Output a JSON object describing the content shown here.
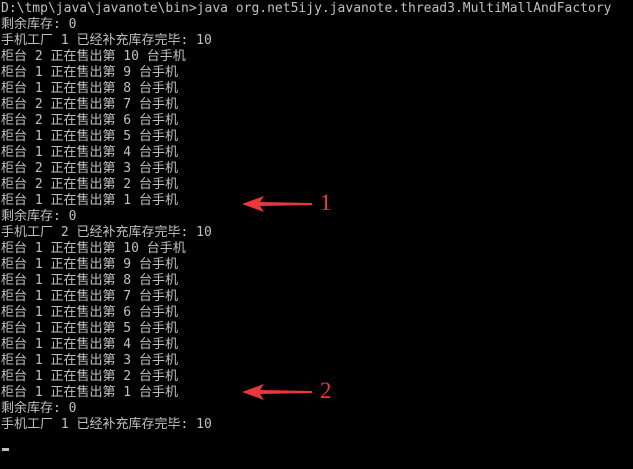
{
  "console": {
    "lines": [
      "D:\\tmp\\java\\javanote\\bin>java org.net5ijy.javanote.thread3.MultiMallAndFactory",
      "剩余库存: 0",
      "手机工厂 1 已经补充库存完毕: 10",
      "柜台 2 正在售出第 10 台手机",
      "柜台 1 正在售出第 9 台手机",
      "柜台 1 正在售出第 8 台手机",
      "柜台 2 正在售出第 7 台手机",
      "柜台 2 正在售出第 6 台手机",
      "柜台 1 正在售出第 5 台手机",
      "柜台 1 正在售出第 4 台手机",
      "柜台 2 正在售出第 3 台手机",
      "柜台 2 正在售出第 2 台手机",
      "柜台 1 正在售出第 1 台手机",
      "剩余库存: 0",
      "手机工厂 2 已经补充库存完毕: 10",
      "柜台 1 正在售出第 10 台手机",
      "柜台 1 正在售出第 9 台手机",
      "柜台 1 正在售出第 8 台手机",
      "柜台 1 正在售出第 7 台手机",
      "柜台 1 正在售出第 6 台手机",
      "柜台 1 正在售出第 5 台手机",
      "柜台 1 正在售出第 4 台手机",
      "柜台 1 正在售出第 3 台手机",
      "柜台 1 正在售出第 2 台手机",
      "柜台 1 正在售出第 1 台手机",
      "剩余库存: 0",
      "手机工厂 1 已经补充库存完毕: 10"
    ]
  },
  "annotations": [
    {
      "label": "1",
      "icon": "left-arrow-icon"
    },
    {
      "label": "2",
      "icon": "left-arrow-icon"
    }
  ],
  "colors": {
    "background": "#000000",
    "text": "#c0c0c0",
    "annotation": "#e8383c"
  }
}
